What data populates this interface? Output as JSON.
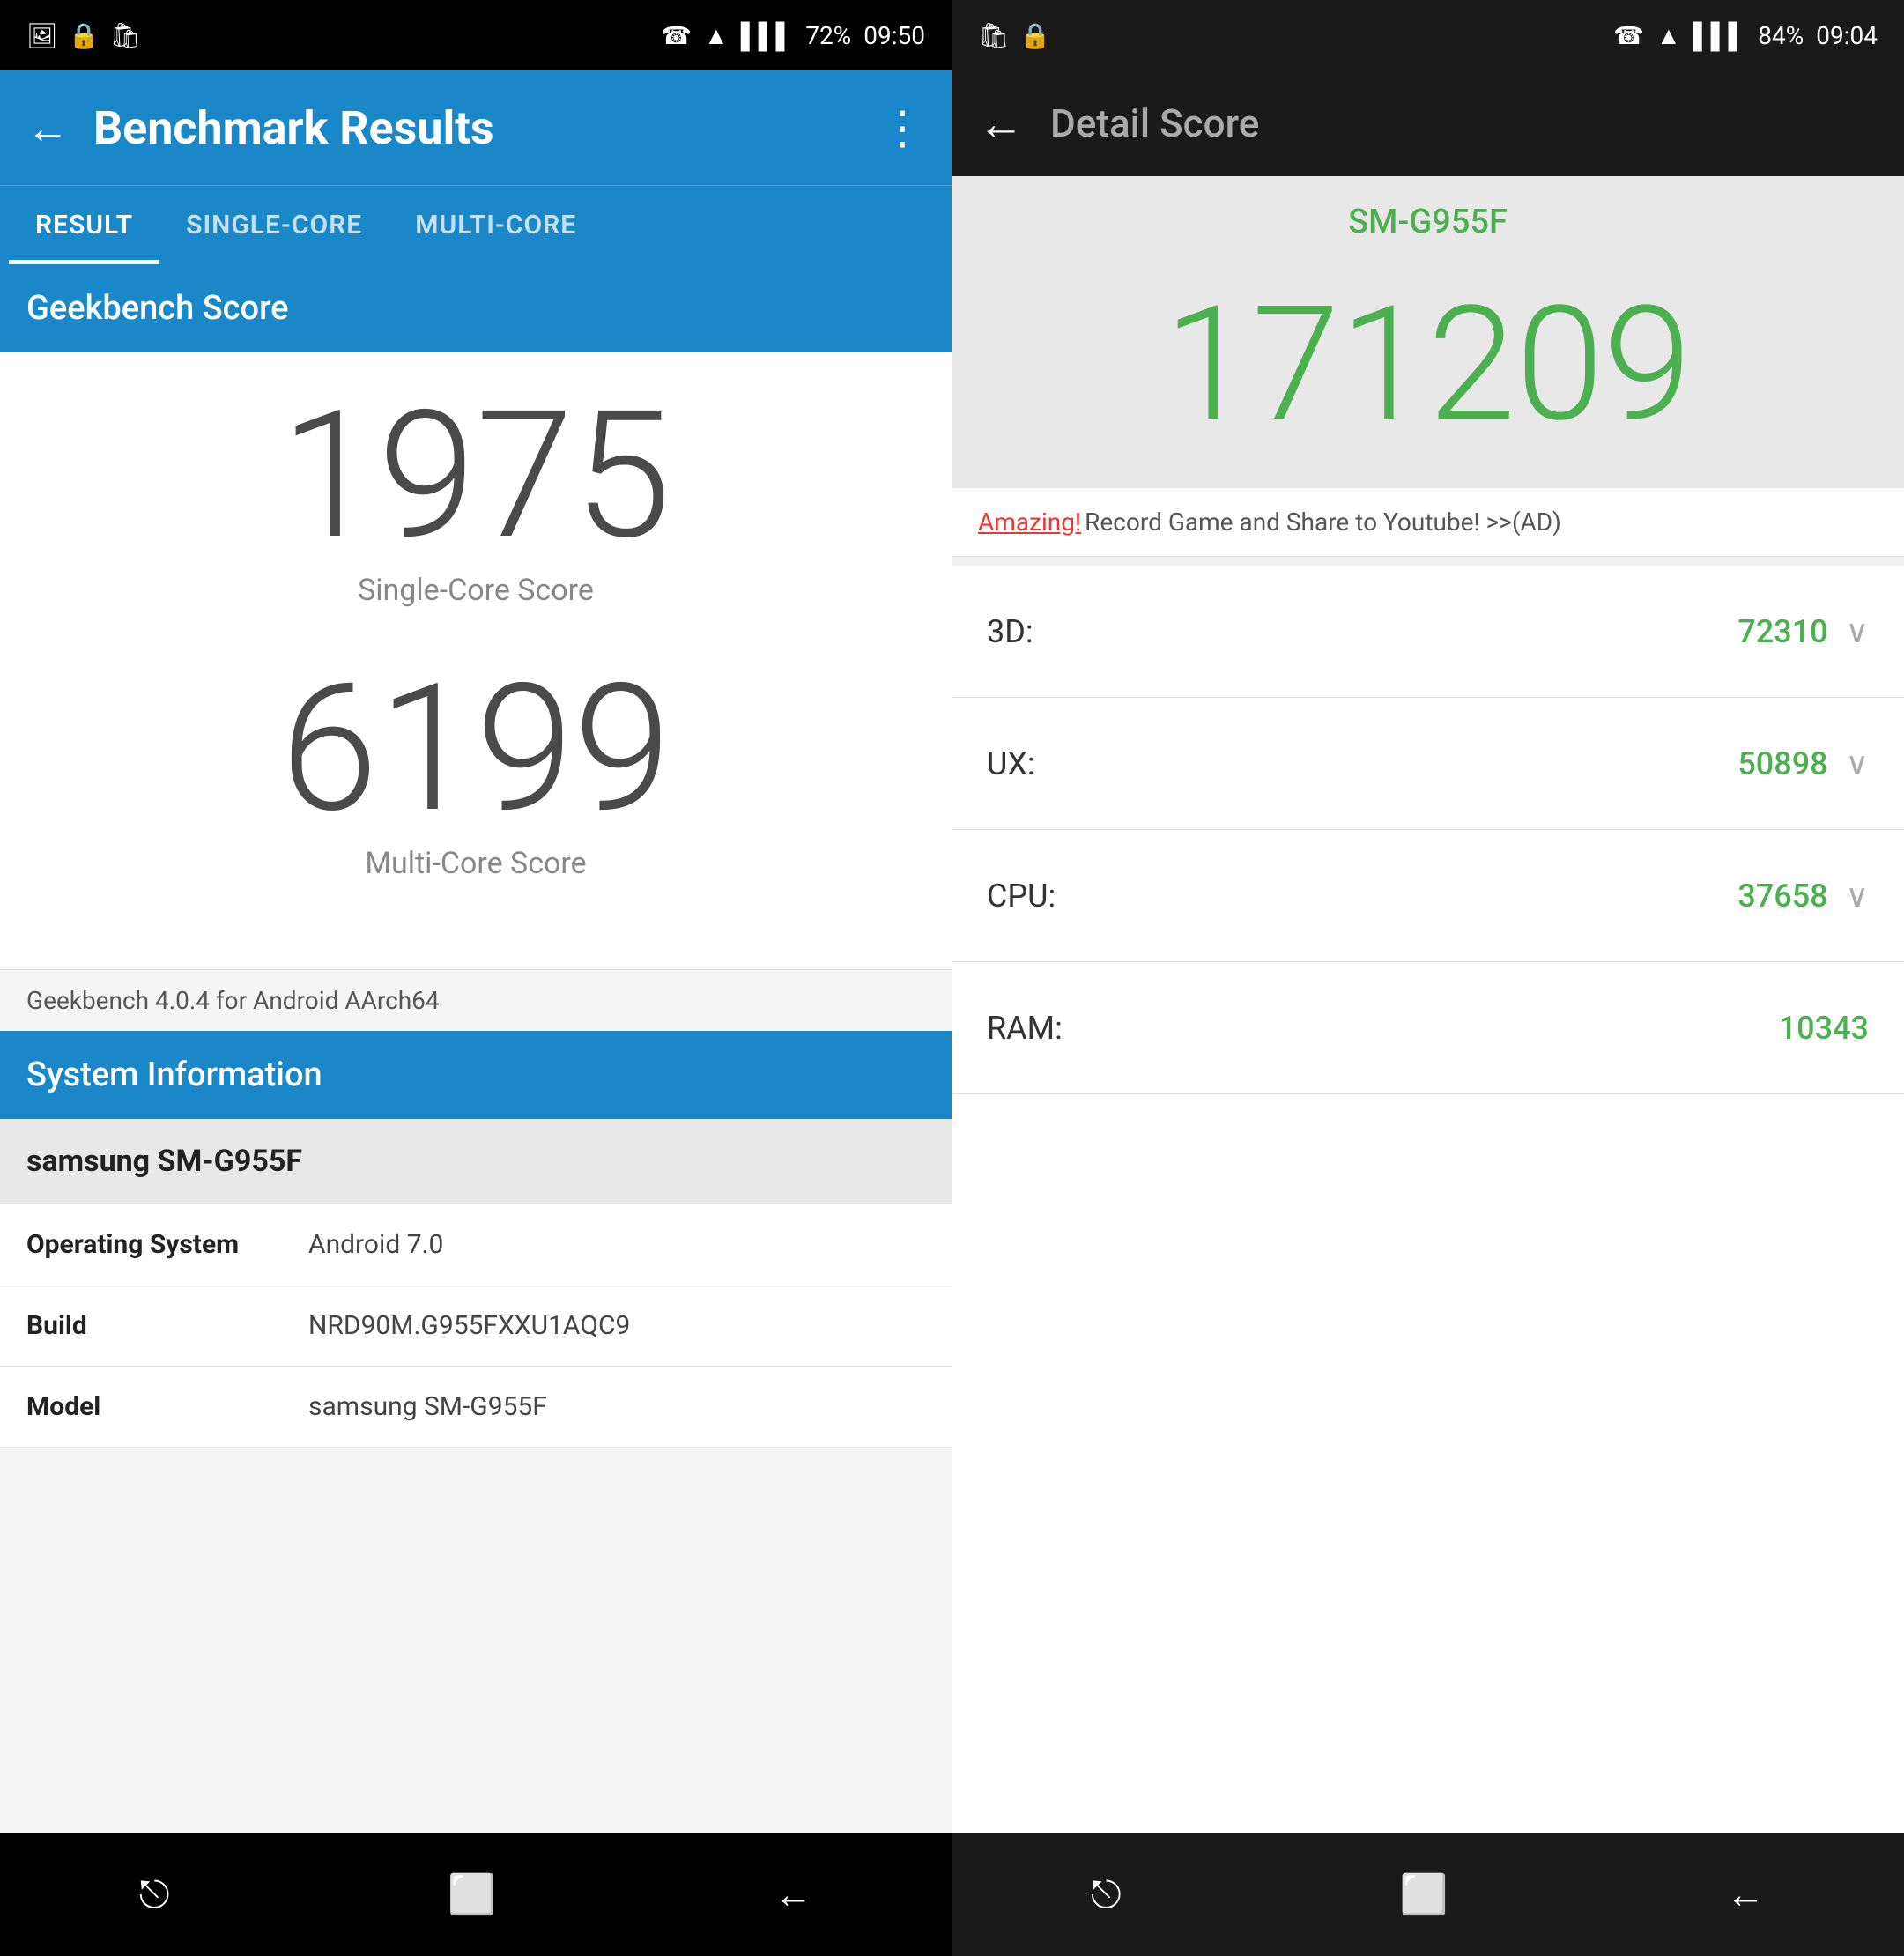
{
  "left": {
    "status_bar": {
      "icons": [
        "photo-icon",
        "lock-icon",
        "bag-icon"
      ],
      "phone_icon": "☎",
      "wifi_icon": "wifi",
      "signal_icon": "signal",
      "battery": "72%",
      "time": "09:50"
    },
    "app_bar": {
      "title": "Benchmark Results",
      "back_label": "←",
      "more_label": "⋮"
    },
    "tabs": [
      {
        "label": "RESULT",
        "active": true
      },
      {
        "label": "SINGLE-CORE",
        "active": false
      },
      {
        "label": "MULTI-CORE",
        "active": false
      }
    ],
    "section_header": "Geekbench Score",
    "single_core_score": "1975",
    "single_core_label": "Single-Core Score",
    "multi_core_score": "6199",
    "multi_core_label": "Multi-Core Score",
    "geekbench_version": "Geekbench 4.0.4 for Android AArch64",
    "system_info_header": "System Information",
    "system_info": {
      "device_name": "samsung SM-G955F",
      "rows": [
        {
          "label": "Operating System",
          "value": "Android 7.0"
        },
        {
          "label": "Build",
          "value": "NRD90M.G955FXXU1AQC9"
        },
        {
          "label": "Model",
          "value": "samsung SM-G955F"
        }
      ]
    },
    "nav_icons": [
      "⎋",
      "⬜",
      "←"
    ]
  },
  "right": {
    "status_bar": {
      "icons": [
        "bag-icon",
        "lock-icon"
      ],
      "phone_icon": "☎",
      "wifi_icon": "wifi",
      "signal_icon": "signal",
      "battery": "84%",
      "time": "09:04"
    },
    "app_bar": {
      "back_label": "←",
      "title": "Detail Score"
    },
    "device_name": "SM-G955F",
    "total_score": "171209",
    "ad": {
      "amazing": "Amazing!",
      "text": " Record Game and Share to Youtube! >>(AD)"
    },
    "score_rows": [
      {
        "label": "3D:",
        "value": "72310"
      },
      {
        "label": "UX:",
        "value": "50898"
      },
      {
        "label": "CPU:",
        "value": "37658"
      },
      {
        "label": "RAM:",
        "value": "10343"
      }
    ],
    "nav_icons": [
      "⎋",
      "⬜",
      "←"
    ]
  }
}
